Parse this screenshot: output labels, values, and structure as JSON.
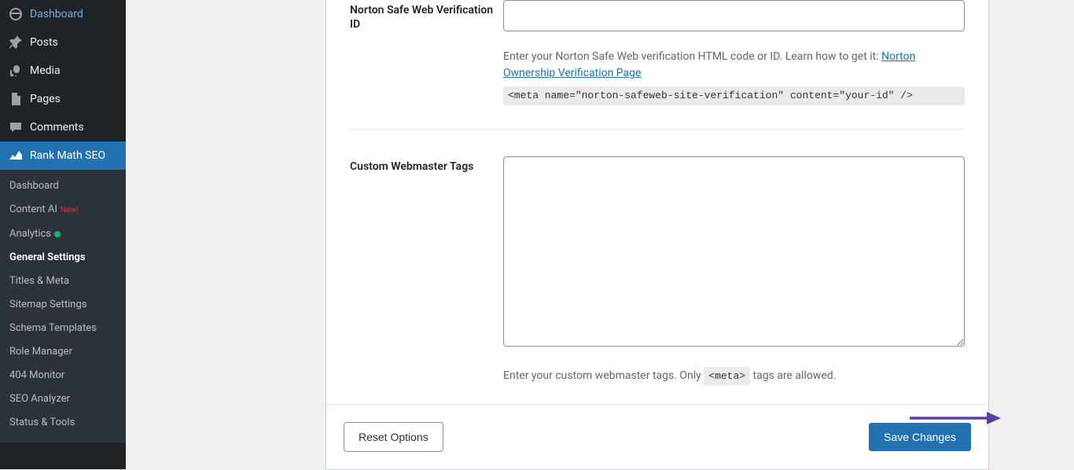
{
  "sidebar": {
    "dashboard": "Dashboard",
    "posts": "Posts",
    "media": "Media",
    "pages": "Pages",
    "comments": "Comments",
    "rankmath": "Rank Math SEO",
    "submenu": {
      "dashboard": "Dashboard",
      "contentai": "Content AI",
      "contentai_badge": "New!",
      "analytics": "Analytics",
      "general": "General Settings",
      "titles": "Titles & Meta",
      "sitemap": "Sitemap Settings",
      "schema": "Schema Templates",
      "role": "Role Manager",
      "monitor": "404 Monitor",
      "analyzer": "SEO Analyzer",
      "status": "Status & Tools"
    }
  },
  "fields": {
    "norton": {
      "label": "Norton Safe Web Verification ID",
      "value": "",
      "help_prefix": "Enter your Norton Safe Web verification HTML code or ID. Learn how to get it: ",
      "help_link_text": "Norton Ownership Verification Page",
      "code_example": "<meta name=\"norton-safeweb-site-verification\" content=\"your-id\" />"
    },
    "custom": {
      "label": "Custom Webmaster Tags",
      "value": "",
      "help_before": "Enter your custom webmaster tags. Only ",
      "help_code": "<meta>",
      "help_after": " tags are allowed."
    }
  },
  "footer": {
    "reset": "Reset Options",
    "save": "Save Changes"
  }
}
